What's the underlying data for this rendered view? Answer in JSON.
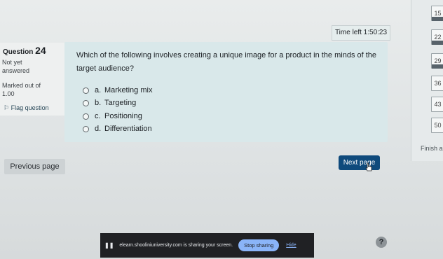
{
  "timer": {
    "label": "Time left 1:50:23"
  },
  "question": {
    "label": "Question",
    "number": "24",
    "status": "Not yet answered",
    "marks": "Marked out of 1.00",
    "flag_label": "Flag question",
    "text": "Which of the following involves creating a unique image for a product in the minds of the target audience?",
    "options": [
      {
        "letter": "a.",
        "text": "Marketing mix"
      },
      {
        "letter": "b.",
        "text": "Targeting"
      },
      {
        "letter": "c.",
        "text": "Positioning"
      },
      {
        "letter": "d.",
        "text": "Differentiation"
      }
    ]
  },
  "buttons": {
    "previous": "Previous page",
    "next": "Next page"
  },
  "nav": {
    "numbers": [
      "15",
      "22",
      "29",
      "36",
      "43",
      "50"
    ],
    "finish": "Finish a"
  },
  "sharing": {
    "message": "elearn.shooliniuniversity.com is sharing your screen.",
    "stop": "Stop sharing",
    "hide": "Hide"
  },
  "help": {
    "label": "?"
  }
}
